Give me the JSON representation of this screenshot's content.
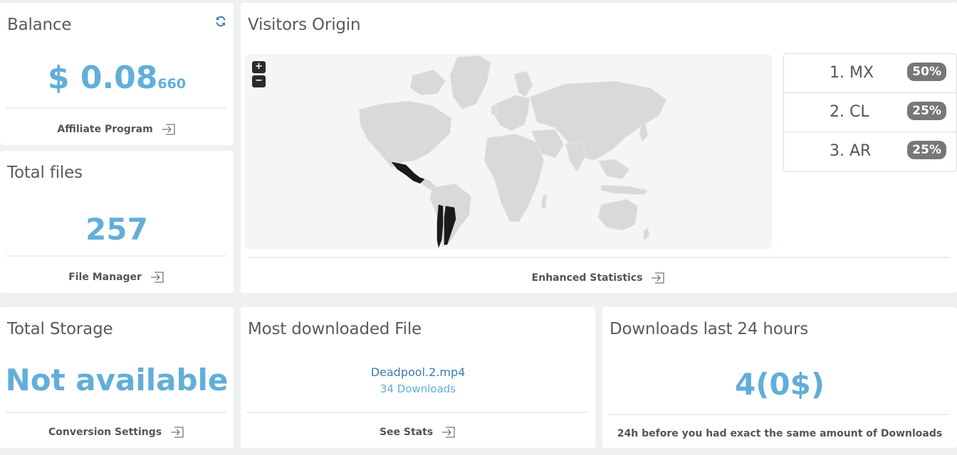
{
  "balance": {
    "title": "Balance",
    "amount_main": "$ 0.08",
    "amount_sub": "660",
    "footer_link": "Affiliate Program"
  },
  "total_files": {
    "title": "Total files",
    "value": "257",
    "footer_link": "File Manager"
  },
  "visitors": {
    "title": "Visitors Origin",
    "zoom_in": "+",
    "zoom_out": "−",
    "ranking": [
      {
        "label": "1. MX",
        "percent": "50%"
      },
      {
        "label": "2. CL",
        "percent": "25%"
      },
      {
        "label": "3. AR",
        "percent": "25%"
      }
    ],
    "footer_link": "Enhanced Statistics",
    "map_base_color": "#d9d9d9",
    "map_highlight_color": "#1a1a1a"
  },
  "total_storage": {
    "title": "Total Storage",
    "value": "Not available",
    "footer_link": "Conversion Settings"
  },
  "most_downloaded": {
    "title": "Most downloaded File",
    "file_name": "Deadpool.2.mp4",
    "downloads": "34 Downloads",
    "footer_link": "See Stats"
  },
  "downloads_24h": {
    "title": "Downloads last 24 hours",
    "value": "4(0$)",
    "footer_text": "24h before you had exact the same amount of Downloads"
  },
  "colors": {
    "accent": "#62aed9",
    "link": "#3d7ab5",
    "badge": "#777777",
    "background": "#eef0f1"
  }
}
